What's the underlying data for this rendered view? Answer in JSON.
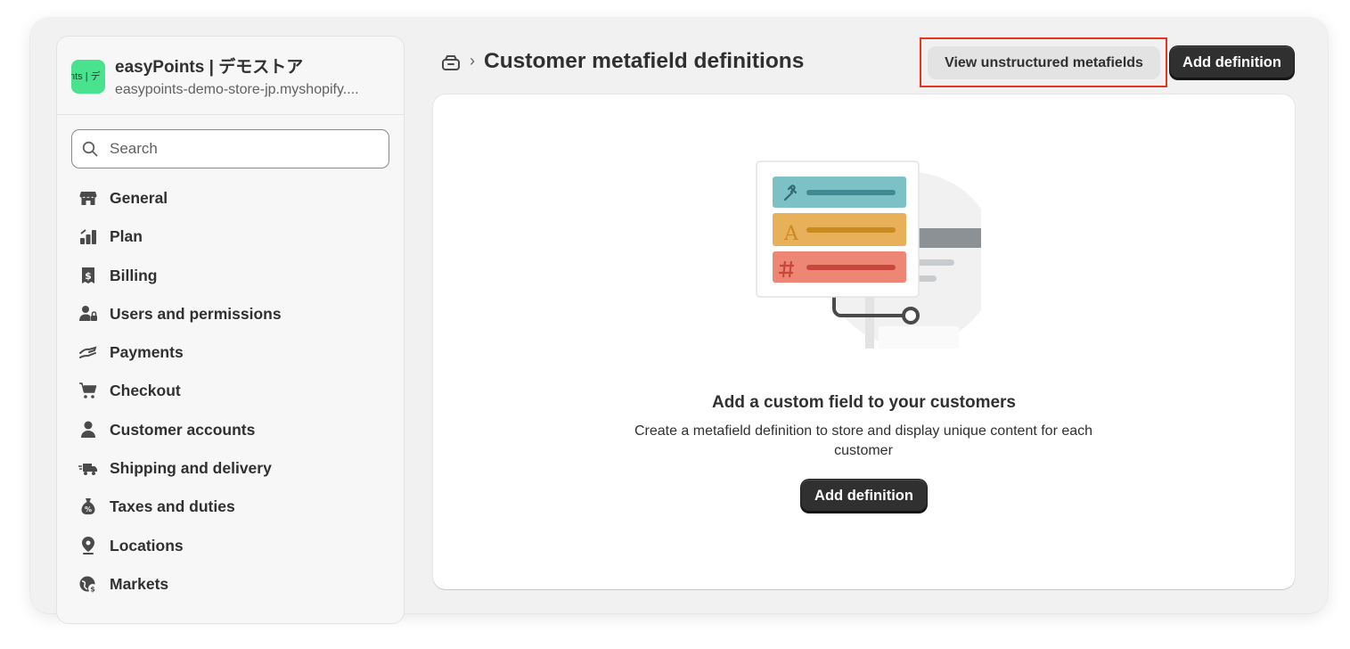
{
  "store": {
    "logo_text": "nts | デ",
    "name": "easyPoints | デモストア",
    "domain": "easypoints-demo-store-jp.myshopify...."
  },
  "search": {
    "placeholder": "Search"
  },
  "sidebar": {
    "items": [
      {
        "label": "General",
        "icon": "store-icon"
      },
      {
        "label": "Plan",
        "icon": "plan-icon"
      },
      {
        "label": "Billing",
        "icon": "billing-icon"
      },
      {
        "label": "Users and permissions",
        "icon": "users-icon"
      },
      {
        "label": "Payments",
        "icon": "payments-icon"
      },
      {
        "label": "Checkout",
        "icon": "cart-icon"
      },
      {
        "label": "Customer accounts",
        "icon": "person-icon"
      },
      {
        "label": "Shipping and delivery",
        "icon": "truck-icon"
      },
      {
        "label": "Taxes and duties",
        "icon": "tax-icon"
      },
      {
        "label": "Locations",
        "icon": "location-icon"
      },
      {
        "label": "Markets",
        "icon": "markets-icon"
      }
    ]
  },
  "header": {
    "breadcrumb_icon": "metafields-icon",
    "separator": "›",
    "title": "Customer metafield definitions",
    "secondary_button": "View unstructured metafields",
    "primary_button": "Add definition"
  },
  "empty_state": {
    "title": "Add a custom field to your customers",
    "description": "Create a metafield definition to store and display unique content for each customer",
    "button": "Add definition"
  },
  "colors": {
    "highlight": "#e8361e",
    "primary_button": "#303030",
    "teal": "#7cc1c6",
    "amber": "#e8b059",
    "coral": "#ee8676"
  }
}
